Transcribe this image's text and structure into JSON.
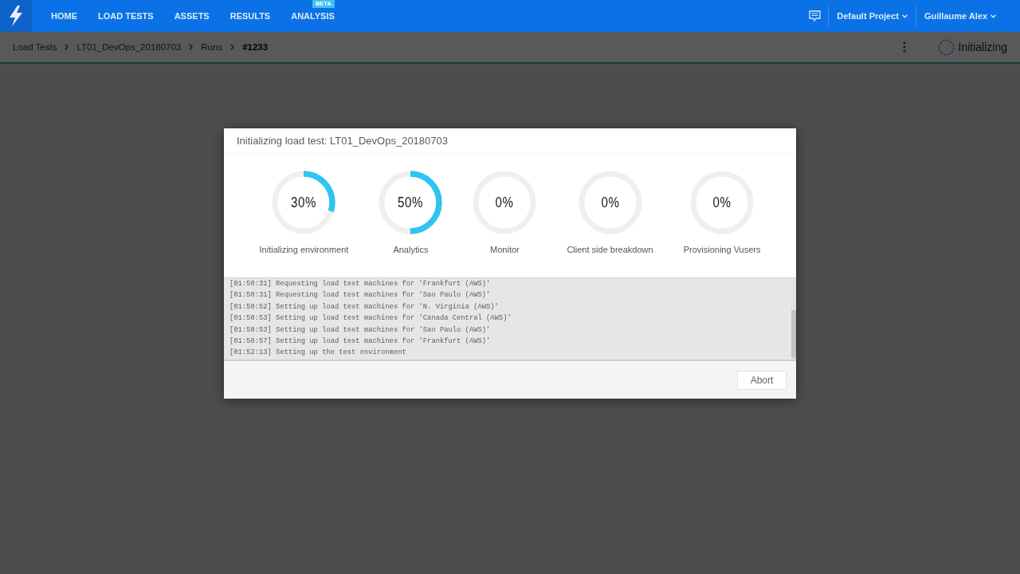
{
  "top_bar": {
    "nav": [
      {
        "label": "HOME"
      },
      {
        "label": "LOAD TESTS"
      },
      {
        "label": "ASSETS"
      },
      {
        "label": "RESULTS"
      },
      {
        "label": "ANALYSIS",
        "badge": "BETA"
      }
    ],
    "project": "Default Project",
    "user": "Guillaume Alex"
  },
  "breadcrumb": {
    "items": [
      {
        "label": "Load Tests",
        "current": false
      },
      {
        "label": "LT01_DevOps_20180703",
        "current": false
      },
      {
        "label": "Runs",
        "current": false
      },
      {
        "label": "#1233",
        "current": true
      }
    ],
    "status": "Initializing"
  },
  "dialog": {
    "title": "Initializing load test: LT01_DevOps_20180703",
    "steps": [
      {
        "percent": "30%",
        "level": 0.3,
        "label": "Initializing environment"
      },
      {
        "percent": "50%",
        "level": 0.5,
        "label": "Analytics"
      },
      {
        "percent": "0%",
        "level": 0,
        "label": "Monitor"
      },
      {
        "percent": "0%",
        "level": 0,
        "label": "Client side breakdown"
      },
      {
        "percent": "0%",
        "level": 0,
        "label": "Provisioning Vusers"
      }
    ],
    "log": [
      "[01:50:31] Requesting load test machines for 'Frankfurt (AWS)'",
      "[01:50:31] Requesting load test machines for 'Sao Paulo (AWS)'",
      "[01:50:52] Setting up load test machines for 'N. Virginia (AWS)'",
      "[01:50:53] Setting up load test machines for 'Canada Central (AWS)'",
      "[01:50:53] Setting up load test machines for 'Sao Paulo (AWS)'",
      "[01:50:57] Setting up load test machines for 'Frankfurt (AWS)'",
      "[01:52:13] Setting up the test environment"
    ],
    "buttons": [
      "Abort"
    ]
  }
}
